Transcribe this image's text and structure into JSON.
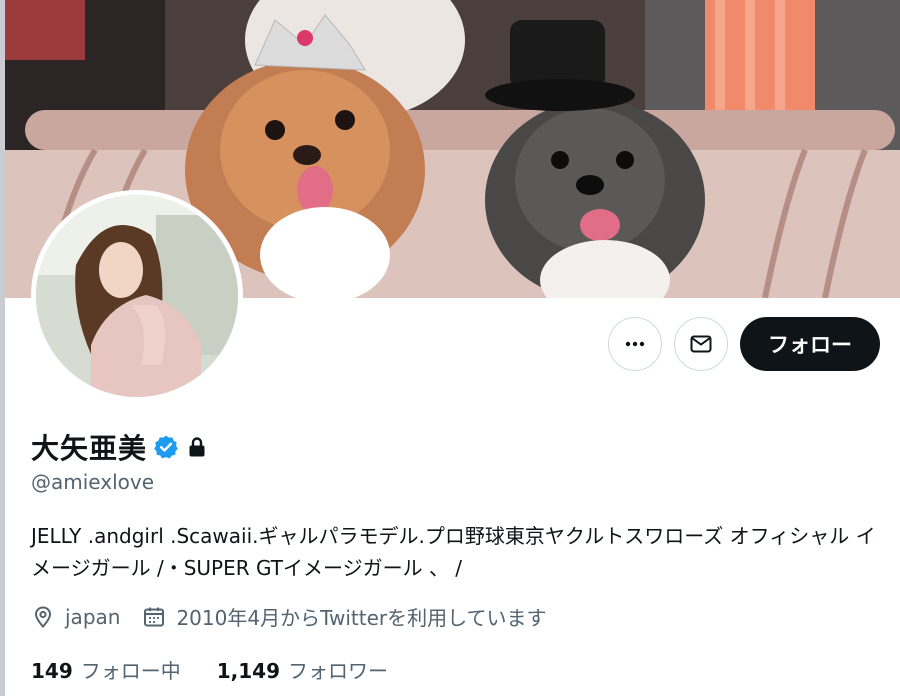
{
  "profile": {
    "display_name": "大矢亜美",
    "handle": "@amiexlove",
    "bio": "JELLY .andgirl .Scawaii.ギャルパラモデル.プロ野球東京ヤクルトスワローズ オフィシャル イメージガール /・SUPER GTイメージガール 、 /",
    "location": "japan",
    "joined": "2010年4月からTwitterを利用しています",
    "verified_icon": "verified-badge-icon",
    "protected_icon": "lock-icon",
    "accent_color": "#1d9bf0"
  },
  "actions": {
    "more_icon": "more-icon",
    "message_icon": "mail-icon",
    "follow_label": "フォロー"
  },
  "stats": {
    "following_count": "149",
    "following_label": "フォロー中",
    "followers_count": "1,149",
    "followers_label": "フォロワー"
  },
  "icons": {
    "location": "location-pin-icon",
    "calendar": "calendar-icon"
  }
}
